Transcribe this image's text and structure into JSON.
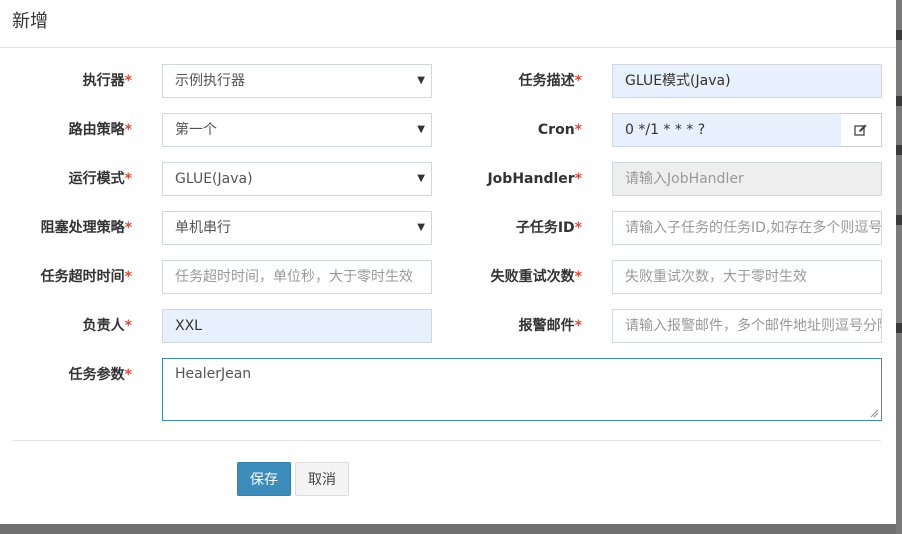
{
  "modal": {
    "title": "新增"
  },
  "form": {
    "executor": {
      "label": "执行器",
      "required": "*",
      "value": "示例执行器"
    },
    "job_desc": {
      "label": "任务描述",
      "required": "*",
      "value": "GLUE模式(Java)"
    },
    "route_strategy": {
      "label": "路由策略",
      "required": "*",
      "value": "第一个"
    },
    "cron": {
      "label": "Cron",
      "required": "*",
      "value": "0 */1 * * * ?",
      "button_icon": "edit-icon"
    },
    "glue_type": {
      "label": "运行模式",
      "required": "*",
      "value": "GLUE(Java)"
    },
    "job_handler": {
      "label": "JobHandler",
      "required": "*",
      "placeholder": "请输入JobHandler"
    },
    "block_strategy": {
      "label": "阻塞处理策略",
      "required": "*",
      "value": "单机串行"
    },
    "child_job_id": {
      "label": "子任务ID",
      "required": "*",
      "placeholder": "请输入子任务的任务ID,如存在多个则逗号分隔"
    },
    "timeout": {
      "label": "任务超时时间",
      "required": "*",
      "placeholder": "任务超时时间，单位秒，大于零时生效"
    },
    "fail_retry": {
      "label": "失败重试次数",
      "required": "*",
      "placeholder": "失败重试次数，大于零时生效"
    },
    "author": {
      "label": "负责人",
      "required": "*",
      "value": "XXL"
    },
    "alarm_email": {
      "label": "报警邮件",
      "required": "*",
      "placeholder": "请输入报警邮件，多个邮件地址则逗号分隔"
    },
    "job_param": {
      "label": "任务参数",
      "required": "*",
      "value": "HealerJean"
    }
  },
  "footer": {
    "save_label": "保存",
    "cancel_label": "取消"
  },
  "colors": {
    "primary": "#3c8dbc",
    "required": "#dd4b39",
    "autofill": "#e8f0fe"
  }
}
